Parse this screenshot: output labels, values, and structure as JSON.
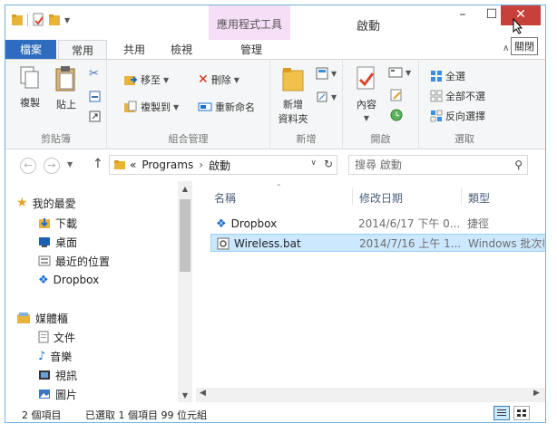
{
  "window": {
    "title": "啟動",
    "context_tab_title": "應用程式工具",
    "close_tooltip": "關閉",
    "minimize_symbol": "–",
    "maximize_symbol": "☐",
    "close_symbol": "✕"
  },
  "ribbon_tabs": [
    "檔案",
    "常用",
    "共用",
    "檢視",
    "管理"
  ],
  "active_tab": "常用",
  "ribbon": {
    "clipboard": {
      "label": "剪貼簿",
      "copy": "複製",
      "paste": "貼上"
    },
    "organize": {
      "label": "組合管理",
      "move_to": "移至",
      "copy_to": "複製到",
      "delete": "刪除",
      "rename": "重新命名"
    },
    "new": {
      "label": "新增",
      "new_folder_line1": "新增",
      "new_folder_line2": "資料夾"
    },
    "open": {
      "label": "開啟",
      "properties": "內容"
    },
    "select": {
      "label": "選取",
      "select_all": "全選",
      "select_none": "全部不選",
      "invert": "反向選擇"
    }
  },
  "address": {
    "chevrons": "«",
    "path": [
      "Programs",
      "啟動"
    ],
    "separator": "›",
    "search_placeholder": "搜尋 啟動"
  },
  "nav_pane": {
    "favorites_label": "我的最愛",
    "favorites": [
      "下載",
      "桌面",
      "最近的位置",
      "Dropbox"
    ],
    "libraries_label": "媒體櫃",
    "libraries": [
      "文件",
      "音樂",
      "視訊",
      "圖片"
    ]
  },
  "columns": {
    "name": "名稱",
    "date": "修改日期",
    "type": "類型"
  },
  "files": [
    {
      "name": "Dropbox",
      "date": "2014/6/17 下午 0...",
      "type": "捷徑",
      "selected": false
    },
    {
      "name": "Wireless.bat",
      "date": "2014/7/16 上午 1...",
      "type": "Windows 批次檔",
      "selected": true
    }
  ],
  "status": {
    "item_count": "2 個項目",
    "selection": "已選取 1 個項目  99 位元組"
  },
  "colors": {
    "file_tab": "#2d6cbf",
    "context_tab": "#f6def7",
    "close_button": "#c7413a",
    "selection_bg": "#cce8ff",
    "selection_border": "#99d1ff"
  }
}
